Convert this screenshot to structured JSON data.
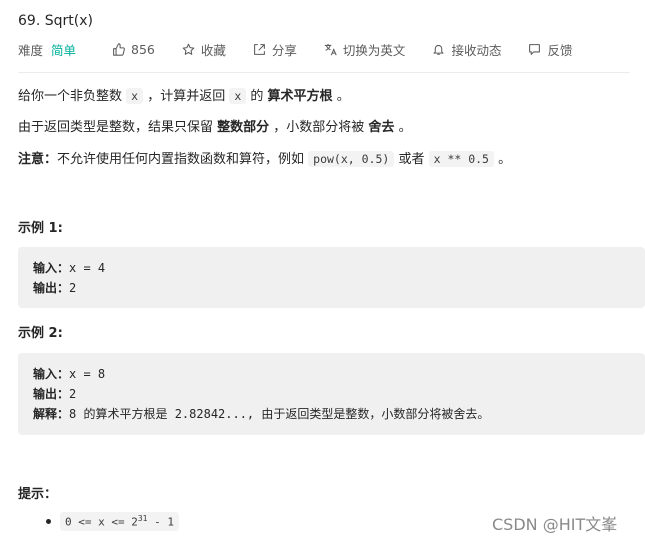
{
  "problem": {
    "title": "69. Sqrt(x)"
  },
  "meta": {
    "difficulty_label": "难度",
    "difficulty_value": "简单",
    "like_count": "856",
    "favorite_label": "收藏",
    "share_label": "分享",
    "translate_label": "切换为英文",
    "notify_label": "接收动态",
    "feedback_label": "反馈",
    "colors": {
      "difficulty_easy": "#00af9b",
      "code_bg": "#f3f3f3",
      "example_bg": "#f0f0f0"
    }
  },
  "description": {
    "p1": {
      "t1": "给你一个非负整数 ",
      "c1": "x",
      "t2": " ，计算并返回 ",
      "c2": "x",
      "t3": " 的 ",
      "b1": "算术平方根",
      "t4": " 。"
    },
    "p2": {
      "t1": "由于返回类型是整数，结果只保留 ",
      "b1": "整数部分",
      "t2": " ，小数部分将被 ",
      "b2": "舍去",
      "t3": " 。"
    },
    "p3": {
      "b1": "注意：",
      "t1": "不允许使用任何内置指数函数和算符，例如 ",
      "c1": "pow(x, 0.5)",
      "t2": " 或者 ",
      "c2": "x ** 0.5",
      "t3": " 。"
    }
  },
  "examples": [
    {
      "title": "示例 1:",
      "input_label": "输入：",
      "input_value": "x = 4",
      "output_label": "输出：",
      "output_value": "2"
    },
    {
      "title": "示例 2:",
      "input_label": "输入：",
      "input_value": "x = 8",
      "output_label": "输出：",
      "output_value": "2",
      "explain_label": "解释：",
      "explain_value": "8 的算术平方根是 2.82842..., 由于返回类型是整数，小数部分将被舍去。"
    }
  ],
  "hints": {
    "title": "提示：",
    "items": [
      {
        "pre": "0 <= x <= 2",
        "sup": "31",
        "post": " - 1"
      }
    ]
  },
  "watermark": "CSDN @HIT文峯",
  "icons": [
    "thumbs-up-icon",
    "star-icon",
    "share-icon",
    "translate-icon",
    "bell-icon",
    "feedback-icon"
  ]
}
